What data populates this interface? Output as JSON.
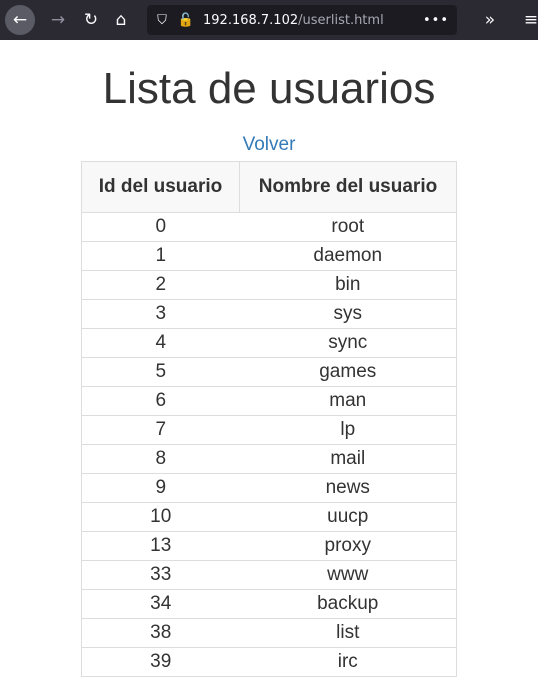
{
  "browser": {
    "back_glyph": "←",
    "forward_glyph": "→",
    "reload_glyph": "↻",
    "home_glyph": "⌂",
    "shield_glyph": "⛉",
    "lock_glyph": "🔓",
    "url_host": "192.168.7.102",
    "url_path": "/userlist.html",
    "more_glyph": "•••",
    "overflow_glyph": "»",
    "menu_glyph": "≡"
  },
  "page": {
    "title": "Lista de usuarios",
    "back_link": "Volver"
  },
  "table": {
    "headers": [
      "Id del usuario",
      "Nombre del usuario"
    ],
    "rows": [
      {
        "id": "0",
        "name": "root"
      },
      {
        "id": "1",
        "name": "daemon"
      },
      {
        "id": "2",
        "name": "bin"
      },
      {
        "id": "3",
        "name": "sys"
      },
      {
        "id": "4",
        "name": "sync"
      },
      {
        "id": "5",
        "name": "games"
      },
      {
        "id": "6",
        "name": "man"
      },
      {
        "id": "7",
        "name": "lp"
      },
      {
        "id": "8",
        "name": "mail"
      },
      {
        "id": "9",
        "name": "news"
      },
      {
        "id": "10",
        "name": "uucp"
      },
      {
        "id": "13",
        "name": "proxy"
      },
      {
        "id": "33",
        "name": "www"
      },
      {
        "id": "34",
        "name": "backup"
      },
      {
        "id": "38",
        "name": "list"
      },
      {
        "id": "39",
        "name": "irc"
      }
    ]
  }
}
